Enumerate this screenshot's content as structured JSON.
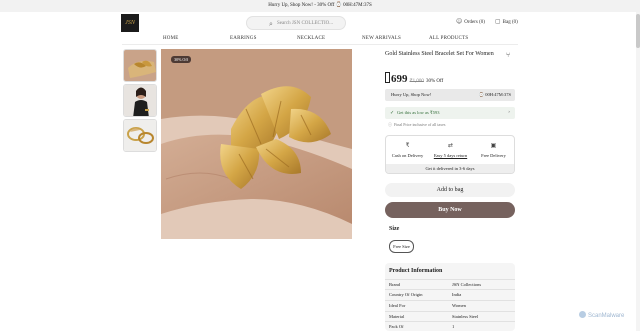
{
  "announcement": "Hurry Up, Shop Now! - 30% Off  ⌚ 00H:47M:37S",
  "header": {
    "logo_text": "JSN",
    "search_placeholder": "Search JSN COLLECTIO...",
    "orders_label": "Orders (0)",
    "bag_label": "Bag (0)"
  },
  "nav": [
    "HOME",
    "EARRINGS",
    "NECKLACE",
    "NEW ARRIVALS",
    "ALL PRODUCTS"
  ],
  "gallery": {
    "discount_badge": "30% Off"
  },
  "product": {
    "title": "Gold Stainless Steel Bracelet Set For Women",
    "price": "699",
    "mrp": "₹1,000",
    "discount": "30% Off",
    "hurry_text": "Hurry Up, Shop Now!",
    "timer": "⌚ 00H:47M:37S",
    "offer_text": "Get this as low as ₹593",
    "tax_note": "Final Price inclusive of all taxes"
  },
  "delivery": {
    "items": [
      {
        "icon": "rupee-icon",
        "label": "Cash on Delivery"
      },
      {
        "icon": "return-icon",
        "label": "Easy 5 days return"
      },
      {
        "icon": "truck-icon",
        "label": "Free Delivery"
      }
    ],
    "eta": "Get it delivered in 3-6 days"
  },
  "actions": {
    "add_to_bag": "Add to bag",
    "buy_now": "Buy Now"
  },
  "size": {
    "label": "Size",
    "selected": "Free Size"
  },
  "info": {
    "heading": "Product Information",
    "rows": [
      {
        "key": "Brand",
        "value": "JSN Collections"
      },
      {
        "key": "Country Of Origin",
        "value": "India"
      },
      {
        "key": "Ideal For",
        "value": "Women"
      },
      {
        "key": "Material",
        "value": "Stainless Steel"
      },
      {
        "key": "Pack Of",
        "value": "1"
      }
    ]
  },
  "watermark": "ScanMalware",
  "colors": {
    "buy_button": "#76625e",
    "offer_green": "#2f6b35",
    "badge": "#4d3a34"
  }
}
